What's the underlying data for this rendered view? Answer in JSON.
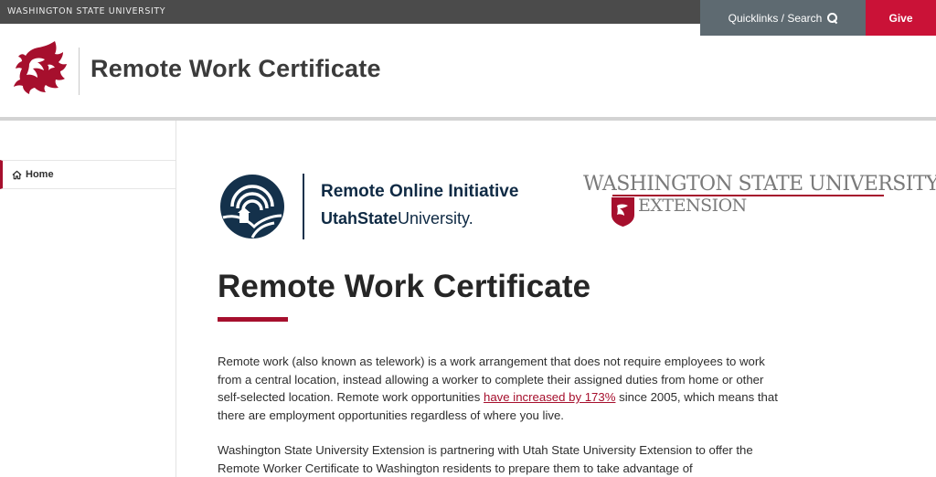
{
  "topbar": {
    "university": "WASHINGTON STATE UNIVERSITY",
    "quicklinks_label": "Quicklinks / Search",
    "give_label": "Give"
  },
  "header": {
    "site_title": "Remote Work Certificate"
  },
  "sidebar": {
    "items": [
      {
        "label": "Home",
        "icon": "home-icon"
      }
    ]
  },
  "partners": {
    "uso": {
      "line1": "Remote Online Initiative",
      "line2_bold": "UtahState",
      "line2_rest": "University",
      "line2_mark": "."
    },
    "wsu_extension": {
      "line1": "WASHINGTON STATE UNIVERSITY",
      "line2": "EXTENSION"
    }
  },
  "main": {
    "title": "Remote Work Certificate",
    "p1_before": "Remote work (also known as telework) is a work arrangement that does not require employees to work from a central location, instead allowing a worker to complete their assigned duties from home or other self-selected location. Remote work opportunities ",
    "p1_link": "have increased by 173%",
    "p1_after": " since 2005, which means that there are employment opportunities regardless of where you live.",
    "p2": "Washington State University Extension is partnering with Utah State University Extension to offer the Remote Worker Certificate to Washington residents to prepare them to take advantage of"
  },
  "colors": {
    "crimson": "#a60f2d",
    "give_red": "#ca1237",
    "topbar_gray": "#4b4b4b",
    "quicklinks_gray": "#5e6a71",
    "usu_navy": "#0f2a44"
  }
}
